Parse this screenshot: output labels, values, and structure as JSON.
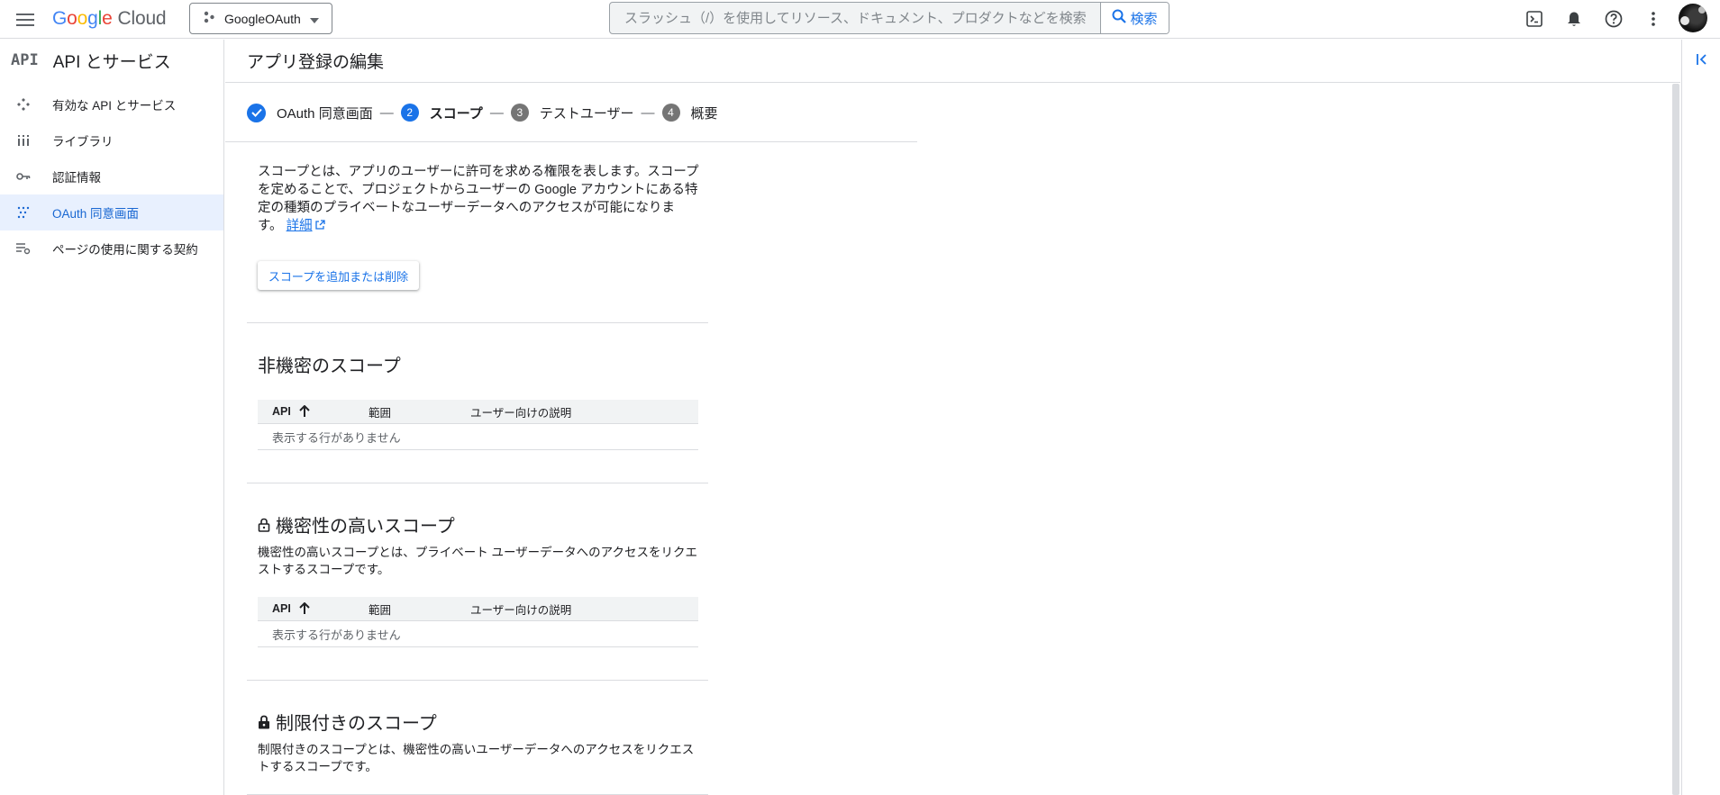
{
  "header": {
    "logo_google": "Google",
    "logo_cloud": "Cloud",
    "project": "GoogleOAuth",
    "search_placeholder": "スラッシュ（/）を使用してリソース、ドキュメント、プロダクトなどを検索",
    "search_button": "検索",
    "icons": [
      "menu-icon",
      "cloud-shell-icon",
      "notifications-icon",
      "help-icon",
      "more-vert-icon"
    ]
  },
  "sidebar": {
    "api_mark": "API",
    "title": "API とサービス",
    "items": [
      {
        "label": "有効な API とサービス",
        "icon": "apis-icon",
        "active": false
      },
      {
        "label": "ライブラリ",
        "icon": "library-icon",
        "active": false
      },
      {
        "label": "認証情報",
        "icon": "key-icon",
        "active": false
      },
      {
        "label": "OAuth 同意画面",
        "icon": "consent-icon",
        "active": true
      },
      {
        "label": "ページの使用に関する契約",
        "icon": "agreements-icon",
        "active": false
      }
    ]
  },
  "main": {
    "title": "アプリ登録の編集",
    "steps": [
      {
        "number": "1",
        "label": "OAuth 同意画面",
        "state": "done"
      },
      {
        "number": "2",
        "label": "スコープ",
        "state": "current"
      },
      {
        "number": "3",
        "label": "テストユーザー",
        "state": "pending"
      },
      {
        "number": "4",
        "label": "概要",
        "state": "pending"
      }
    ],
    "step_separator": "—",
    "intro_text": "スコープとは、アプリのユーザーに許可を求める権限を表します。スコープを定めることで、プロジェクトからユーザーの Google アカウントにある特定の種類のプライベートなユーザーデータへのアクセスが可能になります。",
    "intro_link": "詳細",
    "add_scope_button": "スコープを追加または削除",
    "table_headers": {
      "api": "API",
      "scope": "範囲",
      "desc": "ユーザー向けの説明"
    },
    "empty_text": "表示する行がありません",
    "sections": {
      "non_sensitive": {
        "title": "非機密のスコープ"
      },
      "sensitive": {
        "title": "機密性の高いスコープ",
        "desc": "機密性の高いスコープとは、プライベート ユーザーデータへのアクセスをリクエストするスコープです。"
      },
      "restricted": {
        "title": "制限付きのスコープ",
        "desc": "制限付きのスコープとは、機密性の高いユーザーデータへのアクセスをリクエストするスコープです。"
      }
    }
  },
  "colors": {
    "accent": "#1a73e8",
    "active_bg": "#e8f0fe",
    "border": "#dadce0"
  }
}
